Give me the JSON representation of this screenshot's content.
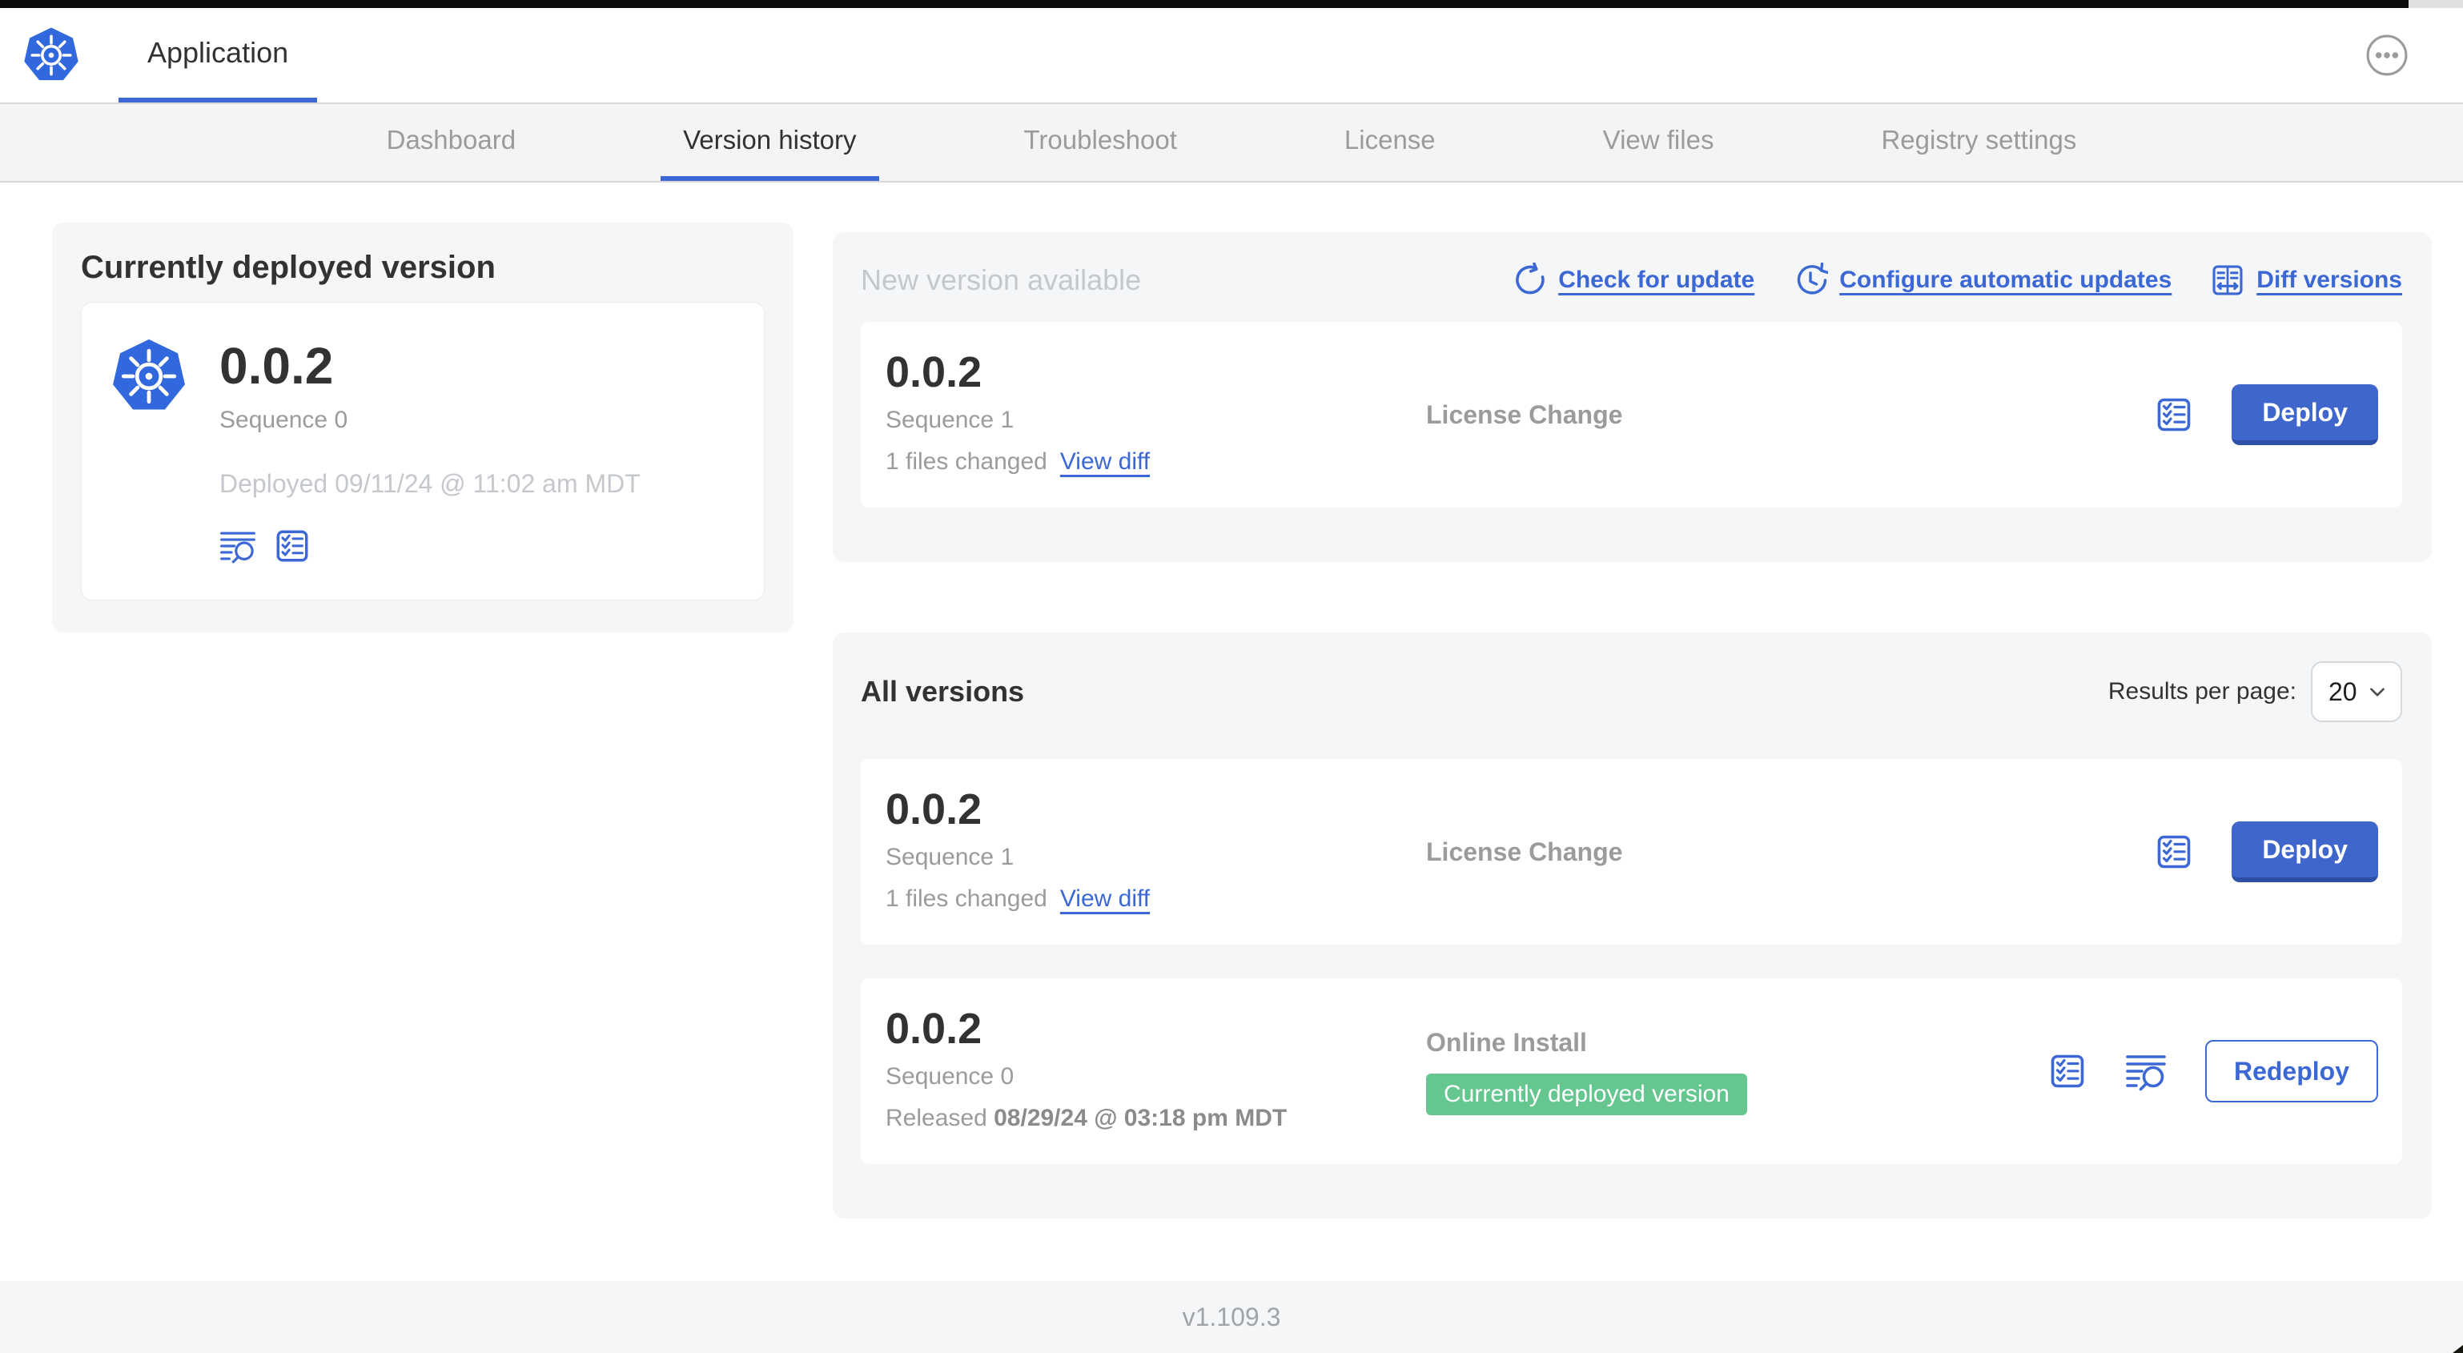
{
  "colors": {
    "accent_blue": "#3b68d4",
    "button_blue": "#3f66cd",
    "button_blue_edge": "#2d4fa6",
    "kubernetes_blue": "#3268dd",
    "badge_green": "#66c690",
    "dark_text": "#323232",
    "gray_text": "#9b9b9b",
    "light_gray_text": "#c4c8cc"
  },
  "header": {
    "app_tab_label": "Application",
    "logo_icon": "kubernetes-logo",
    "more_icon": "ellipsis-icon"
  },
  "nav": {
    "active_tab": "Version history",
    "tabs": [
      {
        "label": "Dashboard"
      },
      {
        "label": "Version history"
      },
      {
        "label": "Troubleshoot"
      },
      {
        "label": "License"
      },
      {
        "label": "View files"
      },
      {
        "label": "Registry settings"
      }
    ]
  },
  "deployed_card": {
    "title": "Currently deployed version",
    "version": "0.0.2",
    "sequence": "Sequence 0",
    "deployed_text": "Deployed 09/11/24 @ 11:02 am MDT",
    "icons": [
      "logs-icon",
      "checklist-icon"
    ]
  },
  "new_version": {
    "heading": "New version available",
    "actions": [
      {
        "icon": "refresh-icon",
        "label": "Check for update"
      },
      {
        "icon": "clock-arrows-icon",
        "label": "Configure automatic updates"
      },
      {
        "icon": "diff-icon",
        "label": "Diff versions"
      }
    ],
    "row": {
      "version": "0.0.2",
      "sequence": "Sequence 1",
      "files_changed": "1 files changed",
      "view_diff_label": "View diff",
      "source": "License Change",
      "deploy_label": "Deploy"
    }
  },
  "all_versions": {
    "heading": "All versions",
    "results_per_page_label": "Results per page:",
    "results_per_page_value": "20",
    "rows": [
      {
        "version": "0.0.2",
        "sequence": "Sequence 1",
        "files_changed": "1 files changed",
        "view_diff_label": "View diff",
        "source": "License Change",
        "action_label": "Deploy"
      },
      {
        "version": "0.0.2",
        "sequence": "Sequence 0",
        "released_prefix": "Released ",
        "released_date": "08/29/24 @ 03:18 pm MDT",
        "source": "Online Install",
        "badge": "Currently deployed version",
        "action_label": "Redeploy"
      }
    ]
  },
  "footer": {
    "version_label": "v1.109.3"
  }
}
